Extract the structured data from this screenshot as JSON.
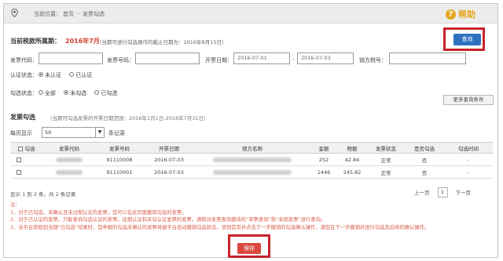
{
  "breadcrumb": {
    "prefix": "当前位置：",
    "home": "首页",
    "separator": "-",
    "current": "发票勾选"
  },
  "help_label": "帮助",
  "tax_period": {
    "label": "当前税款所属期：",
    "value": "2016年7月",
    "note": "（当期可进行勾选操作的截止日期为：2016年8月15日）"
  },
  "query_button": "查询",
  "filters": {
    "invoice_code_label": "发票代码：",
    "invoice_number_label": "发票号码：",
    "issue_date_label": "开票日期：",
    "date_from": "2016-07-01",
    "date_separator": "-",
    "date_to": "2016-07-03",
    "seller_tax_id_label": "销方税号：",
    "auth_status_label": "认证状态：",
    "auth_options": [
      "未认证",
      "已认证"
    ],
    "check_status_label": "勾选状态：",
    "check_options": [
      "全部",
      "未勾选",
      "已勾选"
    ],
    "more_conditions": "更多查询条件"
  },
  "section": {
    "title": "发票勾选",
    "note": "（当期可勾选发票的开票日期范围：2016年1月1日-2016年7月31日）"
  },
  "page_size": {
    "prefix": "每页显示",
    "value": "50",
    "suffix": "条记录"
  },
  "table": {
    "headers": [
      "勾选",
      "发票代码",
      "发票号码",
      "开票日期",
      "销方名称",
      "金额",
      "税额",
      "发票状态",
      "是否勾选",
      "勾选时间"
    ],
    "rows": [
      {
        "number": "91110008",
        "date": "2016-07-03",
        "amount": "252",
        "tax": "42.84",
        "status": "正常",
        "checked": "否",
        "time": "-"
      },
      {
        "number": "91110001",
        "date": "2016-07-03",
        "amount": "1446",
        "tax": "245.82",
        "status": "正常",
        "checked": "否",
        "time": "-"
      }
    ]
  },
  "pager": {
    "info": "显示 1 到 2 条，共 2 条记录",
    "prev": "上一页",
    "current": "1",
    "next": "下一页"
  },
  "notes": [
    "注：",
    "1、对于已勾选、未确认且未过期认证的发票，您可以在此页面撤销勾选的发票。",
    "2、对于已认证的发票，只能查询勾选认证的发票。往期认证和未勾认证发票的发票，请核对发票查询模块的“单票查询”和“本期发票”进行查询。",
    "3、当平台获取到当期“已勾选”结果时，您申报的勾选未确认的发票将被平台自动撤销勾选状态，须到首页并点击下一步撤销的勾选确认操作，请您在下一步撤销并进行勾选及后续的确认操作。"
  ],
  "save_button": "保存",
  "colors": {
    "accent_blue": "#2e72bf",
    "highlight_red": "#c8232c",
    "period_red": "#d23b2c",
    "note_red": "#d9604e",
    "help_orange": "#e3a51c"
  }
}
